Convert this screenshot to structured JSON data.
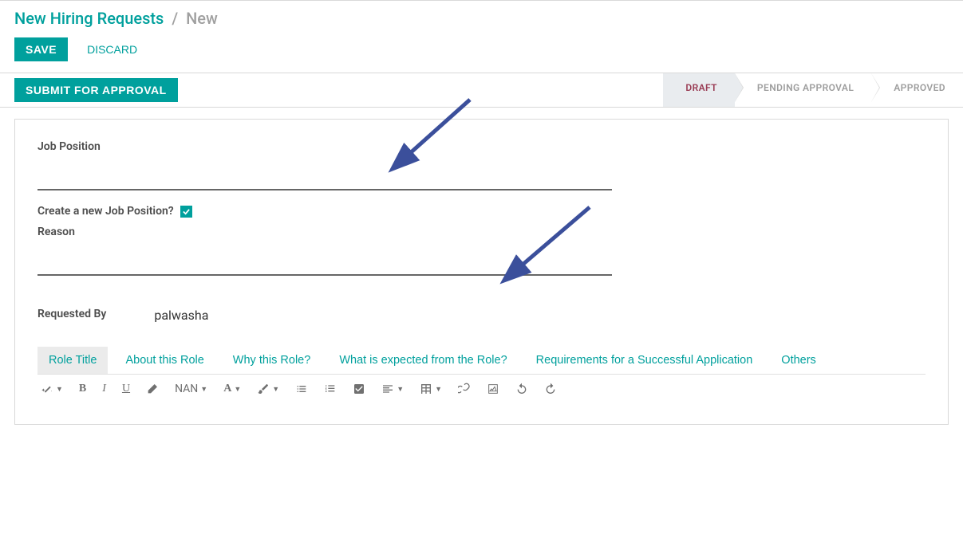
{
  "breadcrumb": {
    "root": "New Hiring Requests",
    "separator": "/",
    "current": "New"
  },
  "actions": {
    "save": "SAVE",
    "discard": "DISCARD",
    "submit": "SUBMIT FOR APPROVAL"
  },
  "stages": [
    {
      "label": "DRAFT",
      "active": true
    },
    {
      "label": "PENDING APPROVAL",
      "active": false
    },
    {
      "label": "APPROVED",
      "active": false
    }
  ],
  "form": {
    "job_position_label": "Job Position",
    "job_position_value": "",
    "create_new_label": "Create a new Job Position?",
    "create_new_checked": true,
    "reason_label": "Reason",
    "reason_value": "",
    "requested_by_label": "Requested By",
    "requested_by_value": "palwasha"
  },
  "tabs": [
    {
      "label": "Role Title",
      "active": true
    },
    {
      "label": "About this Role",
      "active": false
    },
    {
      "label": "Why this Role?",
      "active": false
    },
    {
      "label": "What is expected from the Role?",
      "active": false
    },
    {
      "label": "Requirements for a Successful Application",
      "active": false
    },
    {
      "label": "Others",
      "active": false
    }
  ],
  "toolbar": {
    "font_size": "NAN",
    "font_style": "A"
  }
}
